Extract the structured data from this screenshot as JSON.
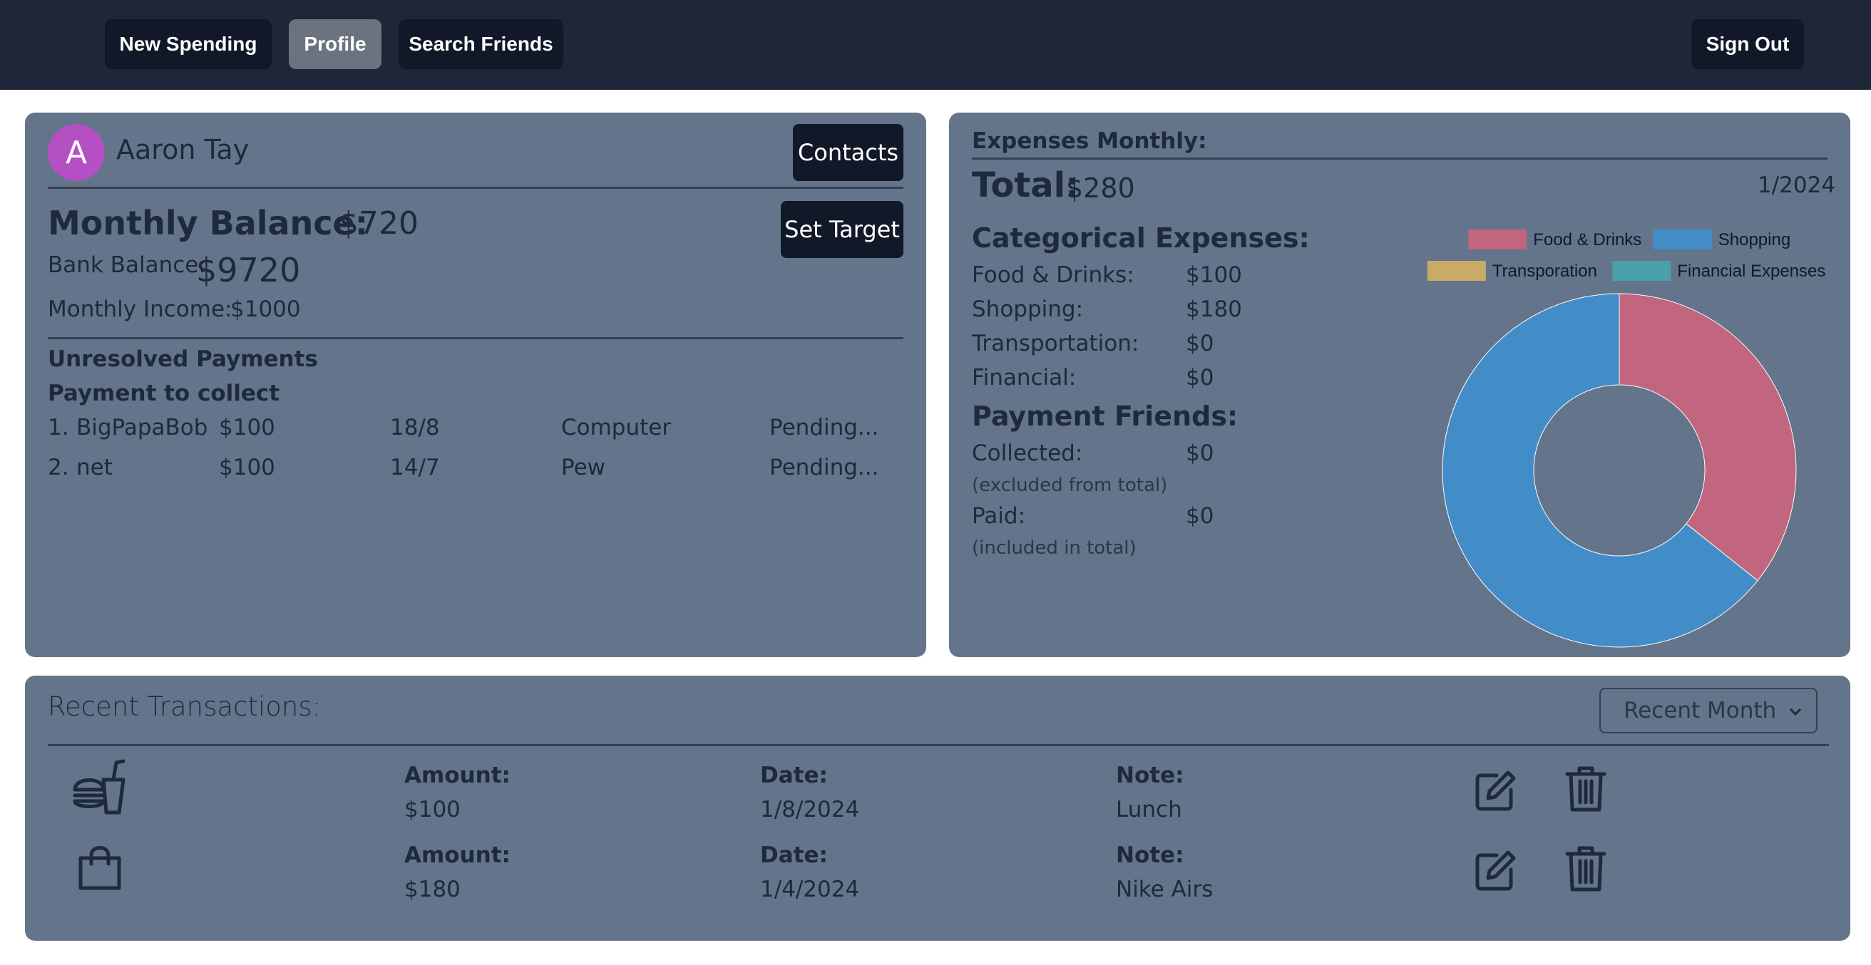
{
  "nav": {
    "new_spending": "New Spending",
    "profile": "Profile",
    "search_friends": "Search Friends",
    "sign_out": "Sign Out"
  },
  "profile": {
    "avatar_letter": "A",
    "name": "Aaron Tay",
    "contacts_label": "Contacts",
    "set_target_label": "Set Target",
    "monthly_balance_label": "Monthly Balance:",
    "monthly_balance_value": "$720",
    "bank_balance_label": "Bank Balance:",
    "bank_balance_value": "$9720",
    "monthly_income_label": "Monthly Income:",
    "monthly_income_value": "$1000",
    "unresolved_heading": "Unresolved Payments",
    "collect_heading": "Payment to collect",
    "payments": [
      {
        "index": "1.",
        "name": "BigPapaBob",
        "amount": "$100",
        "date": "18/8",
        "note": "Computer",
        "status": "Pending..."
      },
      {
        "index": "2.",
        "name": "net",
        "amount": "$100",
        "date": "14/7",
        "note": "Pew",
        "status": "Pending..."
      }
    ]
  },
  "expenses": {
    "heading": "Expenses Monthly:",
    "total_label": "Total:",
    "total_value": "$280",
    "period": "1/2024",
    "categorical_heading": "Categorical Expenses:",
    "categories": [
      {
        "label": "Food & Drinks:",
        "value": "$100"
      },
      {
        "label": "Shopping:",
        "value": "$180"
      },
      {
        "label": "Transportation:",
        "value": "$0"
      },
      {
        "label": "Financial:",
        "value": "$0"
      }
    ],
    "friends_heading": "Payment Friends:",
    "collected_label": "Collected:",
    "collected_value": "$0",
    "collected_note": "(excluded from total)",
    "paid_label": "Paid:",
    "paid_value": "$0",
    "paid_note": "(included in total)"
  },
  "chart_data": {
    "type": "pie",
    "donut": true,
    "categories": [
      "Food & Drinks",
      "Shopping",
      "Transporation",
      "Financial Expenses"
    ],
    "values": [
      100,
      180,
      0,
      0
    ],
    "colors": [
      "#c2657f",
      "#428dc8",
      "#c9ab65",
      "#4aa0a8"
    ],
    "legend_swatch_colors": [
      "#c2657f",
      "#428dc8",
      "#c9ab65",
      "#4aa0a8"
    ],
    "legend_placement": "top"
  },
  "transactions": {
    "heading": "Recent Transactions:",
    "filter_value": "Recent Month",
    "amount_label": "Amount:",
    "date_label": "Date:",
    "note_label": "Note:",
    "rows": [
      {
        "icon": "food-drinks-icon",
        "amount": "$100",
        "date": "1/8/2024",
        "note": "Lunch"
      },
      {
        "icon": "shopping-bag-icon",
        "amount": "$180",
        "date": "1/4/2024",
        "note": "Nike Airs"
      }
    ]
  },
  "colors": {
    "navbar": "#1e2738",
    "card": "#64748b",
    "dark_button": "#111827",
    "active_button": "#6b7280",
    "avatar": "#b44fc4"
  }
}
